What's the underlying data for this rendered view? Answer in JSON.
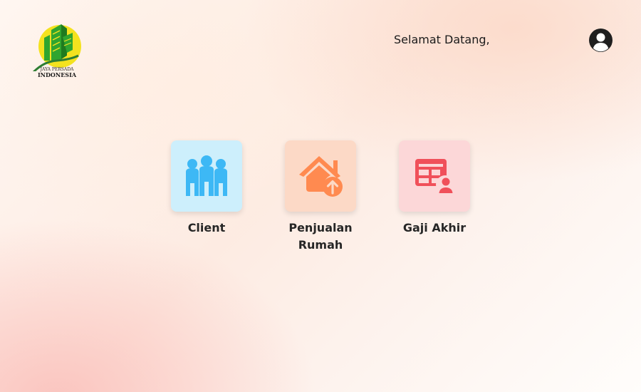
{
  "logo": {
    "line1": "JAYA PERSADA",
    "line2": "INDONESIA"
  },
  "header": {
    "welcome_text": "Selamat Datang,",
    "avatar_icon": "user-circle-icon"
  },
  "menu": {
    "items": [
      {
        "label": "Client",
        "icon": "people-group-icon",
        "color": "#3db8f5",
        "bg": "#cdeffc"
      },
      {
        "label": "Penjualan Rumah",
        "icon": "house-upload-icon",
        "color": "#ff8a50",
        "bg": "#fcd9c6"
      },
      {
        "label": "Gaji Akhir",
        "icon": "salary-table-user-icon",
        "color": "#f0505a",
        "bg": "#fcd7d8"
      }
    ]
  },
  "colors": {
    "logo_circle": "#f4e21f",
    "logo_building": "#2fa52f",
    "text": "#1b1b1b"
  }
}
